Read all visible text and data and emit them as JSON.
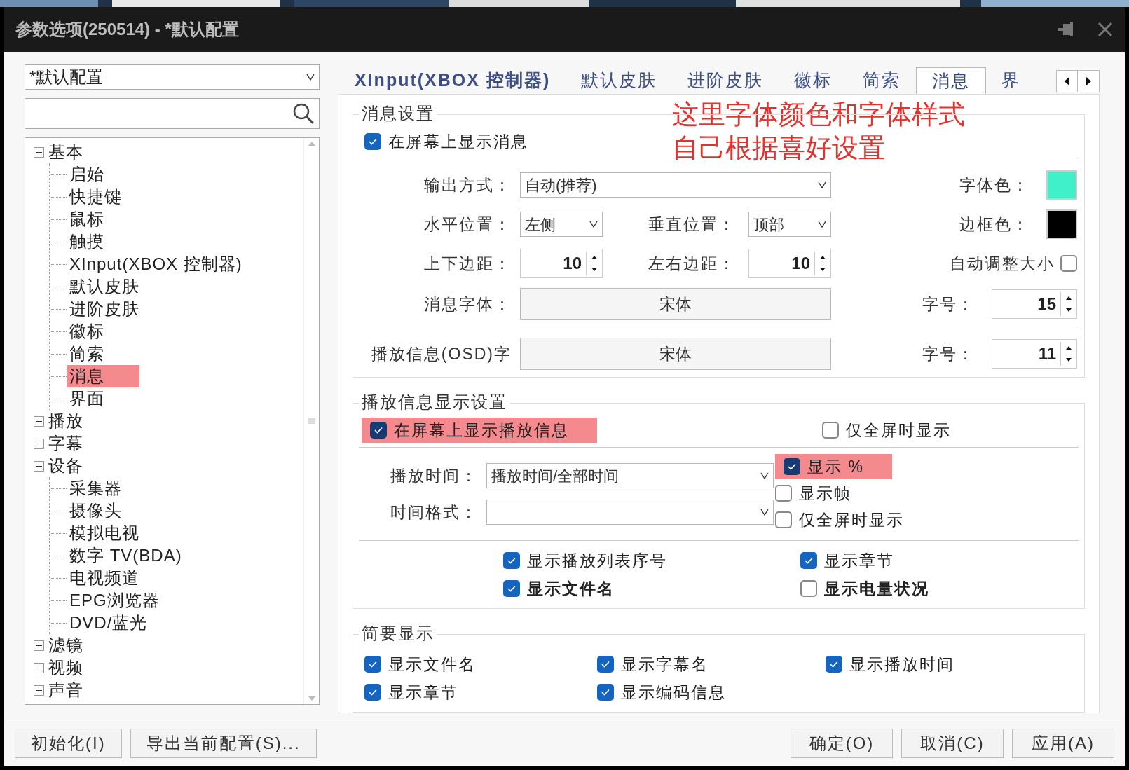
{
  "window": {
    "title": "参数选项(250514) - *默认配置"
  },
  "profile": {
    "value": "*默认配置"
  },
  "tree": [
    {
      "label": "基本",
      "expanded": true,
      "children": [
        {
          "label": "启始"
        },
        {
          "label": "快捷键"
        },
        {
          "label": "鼠标"
        },
        {
          "label": "触摸"
        },
        {
          "label": "XInput(XBOX 控制器)"
        },
        {
          "label": "默认皮肤"
        },
        {
          "label": "进阶皮肤"
        },
        {
          "label": "徽标"
        },
        {
          "label": "简索"
        },
        {
          "label": "消息",
          "highlighted": true
        },
        {
          "label": "界面"
        }
      ]
    },
    {
      "label": "播放",
      "expanded": false
    },
    {
      "label": "字幕",
      "expanded": false
    },
    {
      "label": "设备",
      "expanded": true,
      "children": [
        {
          "label": "采集器"
        },
        {
          "label": "摄像头"
        },
        {
          "label": "模拟电视"
        },
        {
          "label": "数字 TV(BDA)"
        },
        {
          "label": "电视频道"
        },
        {
          "label": "EPG浏览器"
        },
        {
          "label": "DVD/蓝光"
        }
      ]
    },
    {
      "label": "滤镜",
      "expanded": false
    },
    {
      "label": "视频",
      "expanded": false
    },
    {
      "label": "声音",
      "expanded": false
    }
  ],
  "tabs": [
    {
      "label": "XInput(XBOX 控制器)",
      "selected": false,
      "kind": "bold"
    },
    {
      "label": "默认皮肤",
      "selected": false,
      "kind": "plain"
    },
    {
      "label": "进阶皮肤",
      "selected": false,
      "kind": "plain"
    },
    {
      "label": "徽标",
      "selected": false,
      "kind": "plain"
    },
    {
      "label": "简索",
      "selected": false,
      "kind": "plain"
    },
    {
      "label": "消息",
      "selected": true,
      "kind": "plain"
    },
    {
      "label": "界",
      "selected": false,
      "kind": "plain"
    }
  ],
  "annotation": [
    "这里字体颜色和字体样式",
    "自己根据喜好设置"
  ],
  "message_settings": {
    "title": "消息设置",
    "show_message": {
      "label": "在屏幕上显示消息",
      "checked": true
    },
    "output_label": "输出方式：",
    "output_value": "自动(推荐)",
    "swatches": [
      {
        "label": "字体色：",
        "color": "#40f0c8"
      },
      {
        "label": "边框色：",
        "color": "#000000"
      }
    ],
    "h_label": "水平位置：",
    "h_value": "左侧",
    "v_label": "垂直位置：",
    "v_value": "顶部",
    "tb_label": "上下边距：",
    "tb_value": "10",
    "lr_label": "左右边距：",
    "lr_value": "10",
    "auto_size": {
      "label": "自动调整大小",
      "checked": false
    },
    "font_label": "消息字体：",
    "font_value": "宋体",
    "size_label": "字号：",
    "size_value": "15",
    "osd_label": "播放信息(OSD)字",
    "osd_value": "宋体",
    "osd_size_label": "字号：",
    "osd_size_value": "11"
  },
  "playback_settings": {
    "title": "播放信息显示设置",
    "show_info": {
      "label": "在屏幕上显示播放信息",
      "checked": true,
      "highlighted": true
    },
    "fullscreen_only": {
      "label": "仅全屏时显示",
      "checked": false
    },
    "time_label": "播放时间：",
    "time_value": "播放时间/全部时间",
    "format_label": "时间格式：",
    "side": [
      {
        "label": "显示 %",
        "checked": true,
        "highlighted": true
      },
      {
        "label": "显示帧",
        "checked": false,
        "highlighted": false
      },
      {
        "label": "仅全屏时显示",
        "checked": false,
        "highlighted": false
      }
    ],
    "bottom": [
      {
        "label": "显示播放列表序号",
        "checked": true,
        "kind": "plain"
      },
      {
        "label": "显示章节",
        "checked": true,
        "kind": "plain"
      },
      {
        "label": "显示文件名",
        "checked": true,
        "kind": "bold"
      },
      {
        "label": "显示电量状况",
        "checked": false,
        "kind": "bold"
      }
    ]
  },
  "brief": {
    "title": "简要显示",
    "items": [
      {
        "label": "显示文件名",
        "checked": true
      },
      {
        "label": "显示字幕名",
        "checked": true
      },
      {
        "label": "显示播放时间",
        "checked": true
      },
      {
        "label": "显示章节",
        "checked": true
      },
      {
        "label": "显示编码信息",
        "checked": true
      }
    ]
  },
  "buttons_left": [
    "初始化(I)",
    "导出当前配置(S)..."
  ],
  "buttons_right": [
    "确定(O)",
    "取消(C)",
    "应用(A)"
  ]
}
